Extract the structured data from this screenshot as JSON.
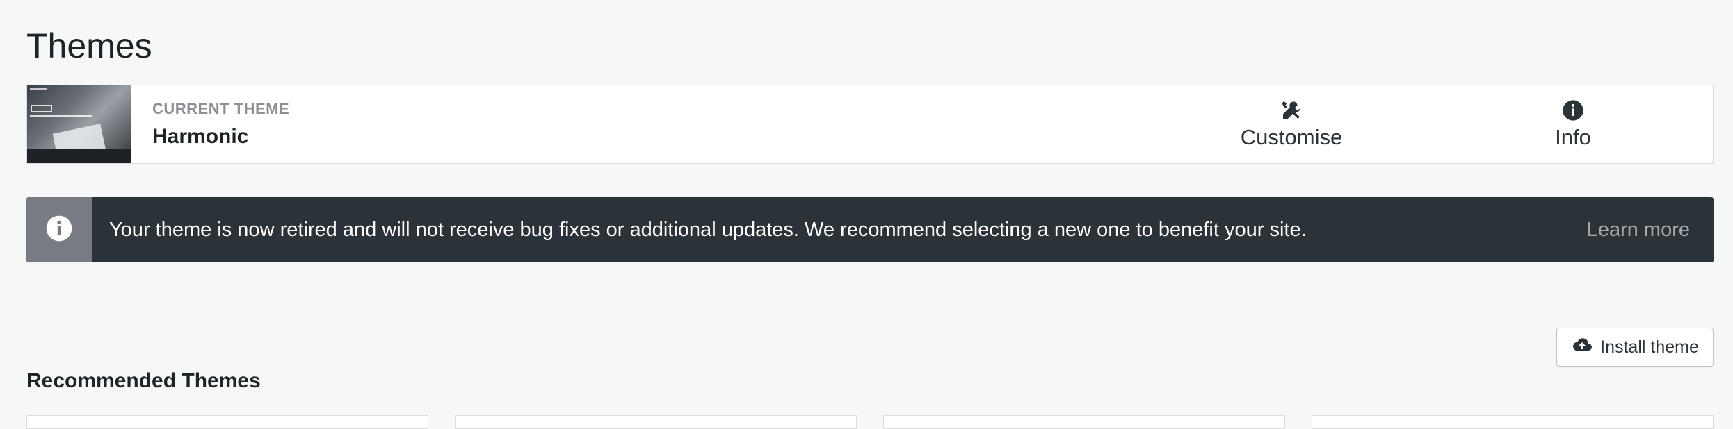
{
  "page": {
    "title": "Themes"
  },
  "current_theme": {
    "label": "CURRENT THEME",
    "name": "Harmonic",
    "actions": [
      {
        "label": "Customise",
        "icon": "tools-icon"
      },
      {
        "label": "Info",
        "icon": "info-icon"
      }
    ]
  },
  "notice": {
    "icon": "info-icon",
    "message": "Your theme is now retired and will not receive bug fixes or additional updates. We recommend selecting a new one to benefit your site.",
    "link": "Learn more"
  },
  "install": {
    "label": "Install theme",
    "icon": "cloud-upload-icon"
  },
  "recommended": {
    "title": "Recommended Themes"
  },
  "colors": {
    "background": "#f6f7f7",
    "notice_bg": "#2c3338",
    "notice_icon_bg": "#787c82",
    "text": "#2c3338"
  }
}
